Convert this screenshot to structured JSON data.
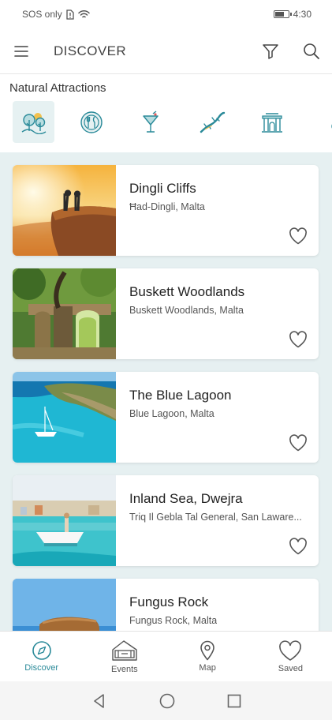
{
  "status": {
    "carrier": "SOS only",
    "time": "4:30",
    "battery_level": 0.7
  },
  "app_bar": {
    "title": "DISCOVER"
  },
  "section": {
    "title": "Natural Attractions"
  },
  "categories": [
    {
      "icon": "nature-trees-icon",
      "active": true
    },
    {
      "icon": "dining-icon",
      "active": false
    },
    {
      "icon": "cocktail-icon",
      "active": false
    },
    {
      "icon": "lizard-icon",
      "active": false
    },
    {
      "icon": "temple-icon",
      "active": false
    },
    {
      "icon": "more-category-icon",
      "active": false
    }
  ],
  "places": [
    {
      "name": "Dingli Cliffs",
      "location": "Ħad-Dingli, Malta",
      "saved": false
    },
    {
      "name": "Buskett Woodlands",
      "location": "Buskett Woodlands, Malta",
      "saved": false
    },
    {
      "name": "The Blue Lagoon",
      "location": "Blue Lagoon, Malta",
      "saved": false
    },
    {
      "name": "Inland Sea, Dwejra",
      "location": "Triq Il Gebla Tal General, San Laware...",
      "saved": false
    },
    {
      "name": "Fungus Rock",
      "location": "Fungus Rock, Malta",
      "saved": false
    }
  ],
  "bottom_nav": [
    {
      "label": "Discover",
      "icon": "compass-icon",
      "active": true
    },
    {
      "label": "Events",
      "icon": "ticket-icon",
      "active": false
    },
    {
      "label": "Map",
      "icon": "map-pin-icon",
      "active": false
    },
    {
      "label": "Saved",
      "icon": "heart-icon",
      "active": false
    }
  ],
  "colors": {
    "accent": "#2a8a99",
    "list_background": "#e6f0f1",
    "category_active": "#e6f1f2"
  }
}
